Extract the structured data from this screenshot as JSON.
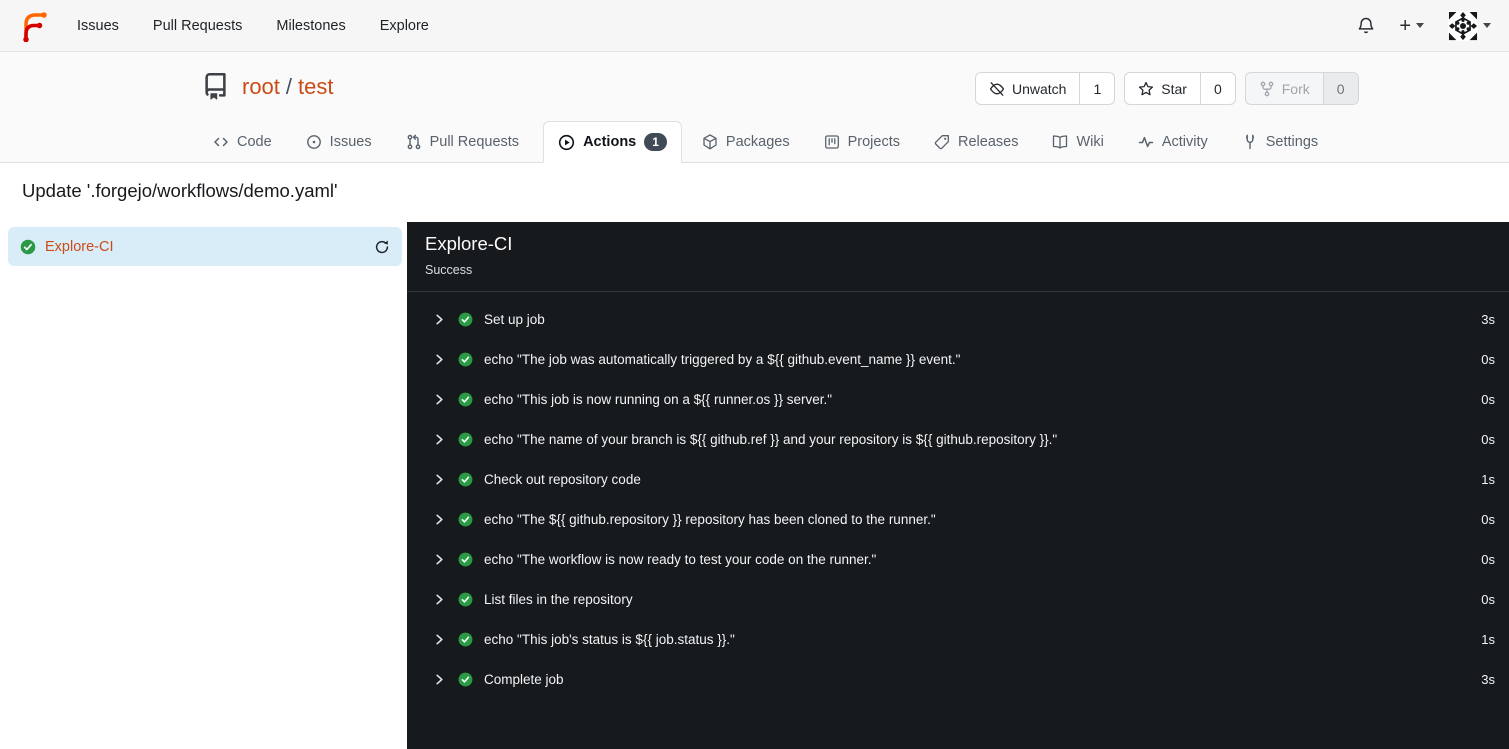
{
  "topnav": {
    "items": [
      {
        "label": "Issues"
      },
      {
        "label": "Pull Requests"
      },
      {
        "label": "Milestones"
      },
      {
        "label": "Explore"
      }
    ],
    "right_icons": [
      "bell-icon",
      "plus-icon",
      "caret-down-icon",
      "avatar-identicon",
      "caret-down-icon"
    ]
  },
  "repo_header": {
    "owner": "root",
    "separator": "/",
    "name": "test",
    "buttons": [
      {
        "label": "Unwatch",
        "count": "1",
        "icon": "eye-slash-icon",
        "disabled": false
      },
      {
        "label": "Star",
        "count": "0",
        "icon": "star-icon",
        "disabled": false
      },
      {
        "label": "Fork",
        "count": "0",
        "icon": "fork-icon",
        "disabled": true
      }
    ]
  },
  "tabs": [
    {
      "label": "Code",
      "icon": "code-icon"
    },
    {
      "label": "Issues",
      "icon": "issue-opened-icon"
    },
    {
      "label": "Pull Requests",
      "icon": "pull-request-icon"
    },
    {
      "label": "Actions",
      "icon": "play-circle-icon",
      "active": true,
      "badge": "1"
    },
    {
      "label": "Packages",
      "icon": "package-icon"
    },
    {
      "label": "Projects",
      "icon": "project-board-icon"
    },
    {
      "label": "Releases",
      "icon": "tag-icon"
    },
    {
      "label": "Wiki",
      "icon": "book-open-icon"
    },
    {
      "label": "Activity",
      "icon": "pulse-icon"
    },
    {
      "label": "Settings",
      "icon": "tools-icon"
    }
  ],
  "page": {
    "title": "Update '.forgejo/workflows/demo.yaml'"
  },
  "sidebar": {
    "job": {
      "name": "Explore-CI",
      "status_icon": "check-circle-icon",
      "action_icon": "refresh-icon"
    }
  },
  "panel": {
    "title": "Explore-CI",
    "status": "Success",
    "steps": [
      {
        "name": "Set up job",
        "duration": "3s"
      },
      {
        "name": "echo \"The job was automatically triggered by a ${{ github.event_name }} event.\"",
        "duration": "0s"
      },
      {
        "name": "echo \"This job is now running on a ${{ runner.os }} server.\"",
        "duration": "0s"
      },
      {
        "name": "echo \"The name of your branch is ${{ github.ref }} and your repository is ${{ github.repository }}.\"",
        "duration": "0s"
      },
      {
        "name": "Check out repository code",
        "duration": "1s"
      },
      {
        "name": "echo \"The ${{ github.repository }} repository has been cloned to the runner.\"",
        "duration": "0s"
      },
      {
        "name": "echo \"The workflow is now ready to test your code on the runner.\"",
        "duration": "0s"
      },
      {
        "name": "List files in the repository",
        "duration": "0s"
      },
      {
        "name": "echo \"This job's status is ${{ job.status }}.\"",
        "duration": "1s"
      },
      {
        "name": "Complete job",
        "duration": "3s"
      }
    ]
  },
  "colors": {
    "accent_link": "#cb4b16",
    "logo_orange": "#ff6600",
    "logo_red": "#d40000",
    "success_green": "#2b9a47",
    "console_background": "#171a1d",
    "selected_job_background": "#d9edf9",
    "badge_background": "#414b57"
  }
}
